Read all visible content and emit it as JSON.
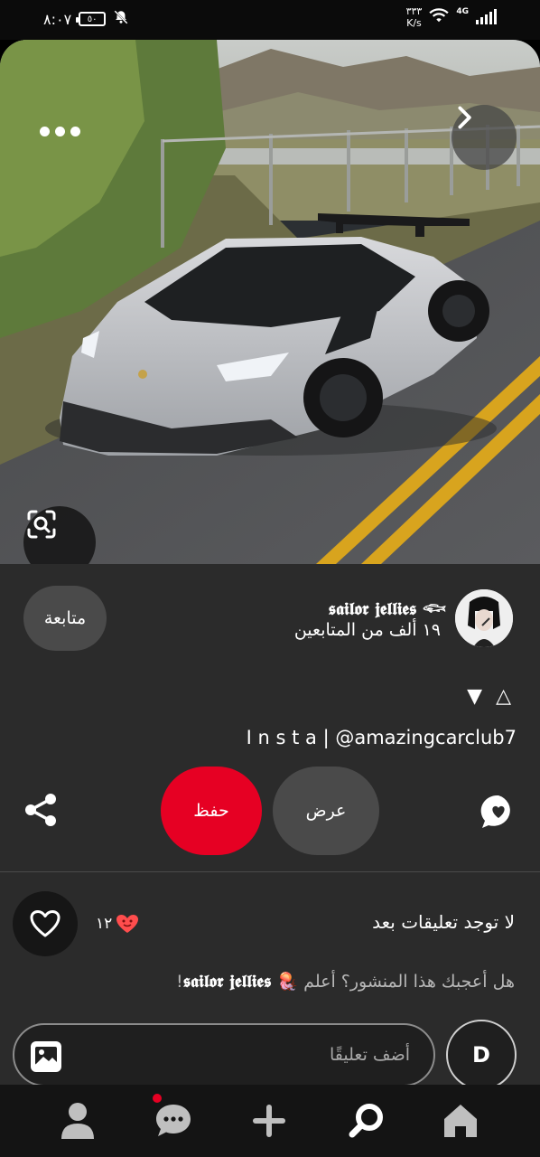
{
  "status_bar": {
    "time": "٨:٠٧",
    "battery": "٥٠",
    "net_speed": "٣٣٣",
    "net_unit": "K/s",
    "network": "4G"
  },
  "pin": {
    "user_name": "𝖘𝖆𝖎𝖑𝖔𝖗 𝖏𝖊𝖑𝖑𝖎𝖊𝖘 𓆟",
    "followers": "١٩ ألف من المتابعين",
    "follow_label": "متابعة",
    "symbols": "▼ △",
    "description": "I n s t a | @amazingcarclub7"
  },
  "actions": {
    "save_label": "حفظ",
    "view_label": "عرض"
  },
  "comments": {
    "no_comments": "لا توجد تعليقات بعد",
    "reaction_count": "١٢",
    "prompt_text": "هل أعجبك هذا المنشور؟ أعلم 🪼 ",
    "prompt_name": "𝖘𝖆𝖎𝖑𝖔𝖗 𝖏𝖊𝖑𝖑𝖎𝖊𝖘",
    "prompt_end": "!",
    "input_placeholder": "أضف تعليقًا",
    "my_avatar_letter": "D"
  },
  "colors": {
    "accent": "#e60023",
    "panel": "#2b2b2b"
  },
  "nav": {
    "items": [
      "profile-icon",
      "messages-icon",
      "create-icon",
      "search-icon",
      "home-icon"
    ]
  }
}
